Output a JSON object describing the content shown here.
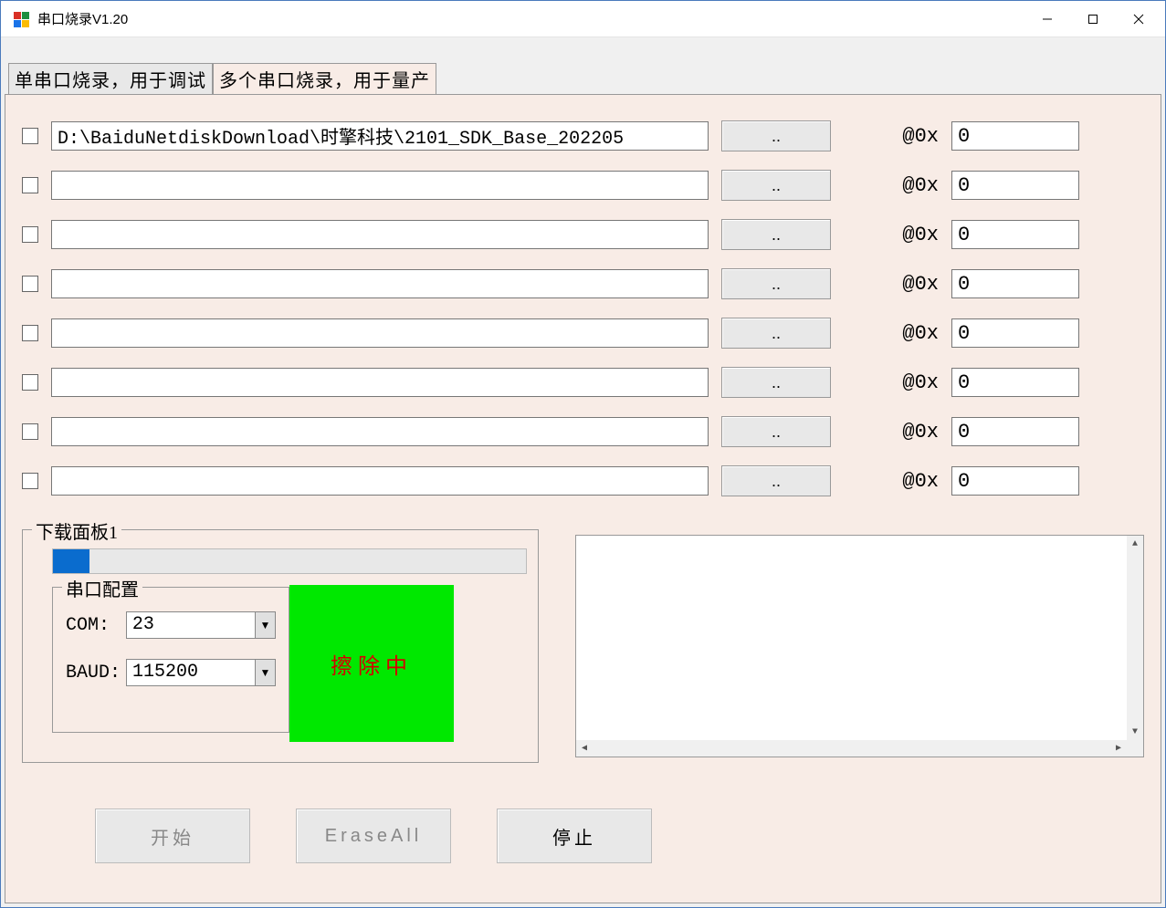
{
  "window": {
    "title": "串口烧录V1.20"
  },
  "tabs": {
    "single": "单串口烧录，用于调试",
    "multi": "多个串口烧录，用于量产"
  },
  "file_rows": [
    {
      "path": "D:\\BaiduNetdiskDownload\\时擎科技\\2101_SDK_Base_202205",
      "addr": "0"
    },
    {
      "path": "",
      "addr": "0"
    },
    {
      "path": "",
      "addr": "0"
    },
    {
      "path": "",
      "addr": "0"
    },
    {
      "path": "",
      "addr": "0"
    },
    {
      "path": "",
      "addr": "0"
    },
    {
      "path": "",
      "addr": "0"
    },
    {
      "path": "",
      "addr": "0"
    }
  ],
  "labels": {
    "browse": "..",
    "at": "@0x"
  },
  "download_panel": {
    "legend": "下载面板1",
    "serial_legend": "串口配置",
    "com_label": "COM:",
    "baud_label": "BAUD:",
    "com_value": "23",
    "baud_value": "115200",
    "status": "擦除中"
  },
  "buttons": {
    "start": "开始",
    "erase_all": "EraseAll",
    "stop": "停止"
  }
}
